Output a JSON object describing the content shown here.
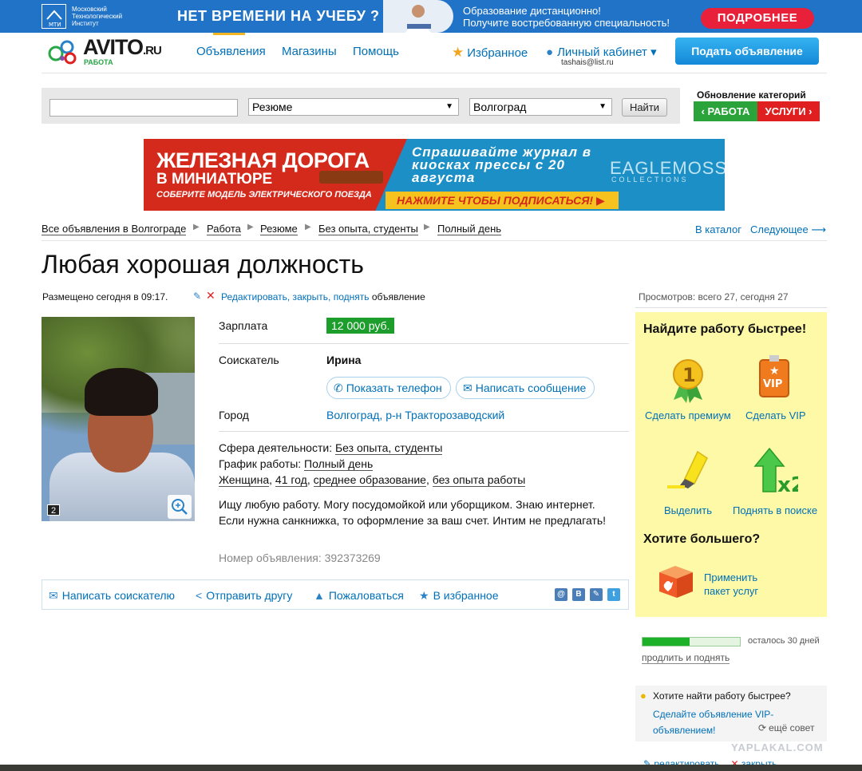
{
  "top_banner": {
    "institute_name": "Московский Технологический Институт",
    "institute_abbr": "МТИ",
    "headline": "НЕТ ВРЕМЕНИ НА УЧЕБУ ?",
    "text_line1": "Образование дистанционно!",
    "text_line2": "Получите востребованную специальность!",
    "button": "ПОДРОБНЕЕ"
  },
  "header": {
    "logo": "AVITO",
    "logo_tld": ".RU",
    "logo_sub": "РАБОТА",
    "nav": [
      "Объявления",
      "Магазины",
      "Помощь"
    ],
    "favorites": "Избранное",
    "cabinet": "Личный кабинет ▾",
    "email": "tashais@list.ru",
    "post_button": "Подать объявление"
  },
  "search": {
    "query_value": "",
    "category": "Резюме",
    "city": "Волгоград",
    "button": "Найти",
    "update_title": "Обновление категорий",
    "tag_work": "‹ РАБОТА",
    "tag_services": "УСЛУГИ ›"
  },
  "ad_banner": {
    "title1": "ЖЕЛЕЗНАЯ ДОРОГА",
    "title2": "В МИНИАТЮРЕ",
    "subtitle": "СОБЕРИТЕ МОДЕЛЬ ЭЛЕКТРИЧЕСКОГО ПОЕЗДА",
    "right_text": "Спрашивайте журнал в киосках прессы с 20 августа",
    "brand": "EAGLEMOSS",
    "brand_sub": "COLLECTIONS",
    "cta": "НАЖМИТЕ ЧТОБЫ ПОДПИСАТЬСЯ! ▶"
  },
  "breadcrumb": {
    "items": [
      "Все объявления в Волгограде",
      "Работа",
      "Резюме",
      "Без опыта, студенты",
      "Полный день"
    ],
    "catalog": "В каталог",
    "next": "Следующее ⟶"
  },
  "listing": {
    "title": "Любая хорошая должность",
    "posted": "Размещено сегодня в 09:17.",
    "edit_links": "Редактировать, закрыть, поднять",
    "edit_suffix": " объявление",
    "photo_count": "2",
    "salary_label": "Зарплата",
    "salary": "12 000 руб.",
    "applicant_label": "Соискатель",
    "applicant": "Ирина",
    "show_phone": "Показать телефон",
    "write_message": "Написать сообщение",
    "city_label": "Город",
    "city": "Волгоград, р-н Тракторозаводский",
    "sphere_label": "Сфера деятельности: ",
    "sphere": "Без опыта, студенты",
    "schedule_label": "График работы: ",
    "schedule": "Полный день",
    "gender": "Женщина",
    "age": "41 год",
    "education": "среднее образование",
    "experience": "без опыта работы",
    "description_line1": "Ищу любую работу. Могу посудомойкой или уборщиком. Знаю интернет.",
    "description_line2": "Если нужна санкнижка, то оформление за ваш счет. Интим не предлагать!",
    "ad_number": "Номер объявления: 392373269"
  },
  "actions": {
    "write": "Написать соискателю",
    "send": "Отправить другу",
    "report": "Пожаловаться",
    "favorite": "В избранное",
    "social": [
      "@",
      "В",
      "✎",
      "t"
    ]
  },
  "sidebar": {
    "views": "Просмотров: всего 27, сегодня 27",
    "promo_title": "Найдите работу быстрее!",
    "premium": "Сделать премиум",
    "vip": "Сделать VIP",
    "vip_badge": "VIP",
    "highlight": "Выделить",
    "raise": "Поднять в поиске",
    "raise_badge": "x2",
    "more_title": "Хотите большего?",
    "package_line1": "Применить",
    "package_line2": "пакет услуг",
    "progress_fraction": 0.48,
    "days_left": "осталось 30 дней",
    "extend": "продлить и поднять",
    "tip_title": "Хотите найти работу быстрее?",
    "tip_link": "Сделайте объявление VIP-объявлением!",
    "tip_more": "ещё совет",
    "bottom_edit": "редактировать",
    "bottom_close": "закрыть"
  },
  "watermark": "YAPLAKAL.COM",
  "colors": {
    "brand_blue": "#2173c8",
    "link": "#0070b8",
    "salary_green": "#1d9e2c",
    "promo_yellow": "#fdf9a6"
  }
}
